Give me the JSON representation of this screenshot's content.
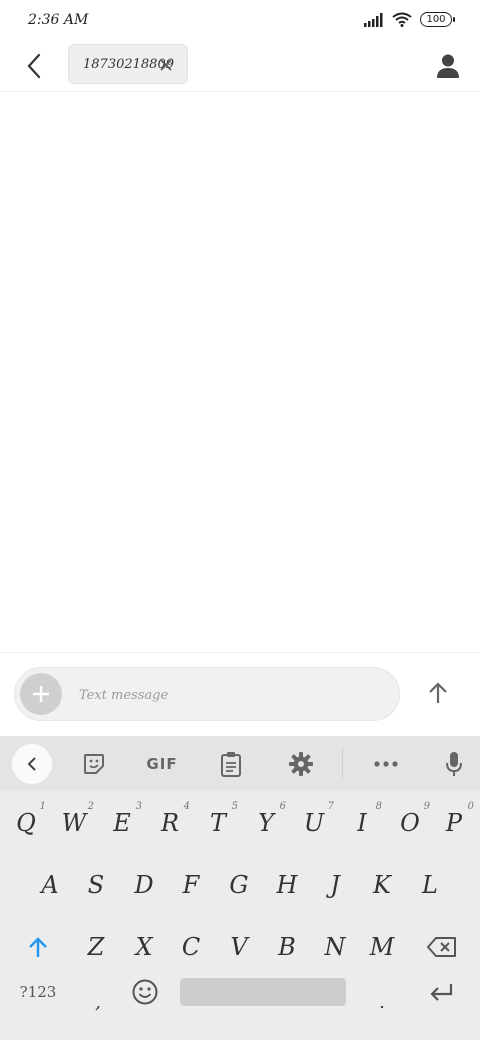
{
  "status_bar": {
    "time": "2:36 AM",
    "battery": "100"
  },
  "header": {
    "recipient": "18730218809"
  },
  "composer": {
    "placeholder": "Text message"
  },
  "keyboard": {
    "toolbar": {
      "gif_label": "GIF"
    },
    "row1": [
      {
        "label": "Q",
        "hint": "1"
      },
      {
        "label": "W",
        "hint": "2"
      },
      {
        "label": "E",
        "hint": "3"
      },
      {
        "label": "R",
        "hint": "4"
      },
      {
        "label": "T",
        "hint": "5"
      },
      {
        "label": "Y",
        "hint": "6"
      },
      {
        "label": "U",
        "hint": "7"
      },
      {
        "label": "I",
        "hint": "8"
      },
      {
        "label": "O",
        "hint": "9"
      },
      {
        "label": "P",
        "hint": "0"
      }
    ],
    "row2": [
      "A",
      "S",
      "D",
      "F",
      "G",
      "H",
      "J",
      "K",
      "L"
    ],
    "row3": [
      "Z",
      "X",
      "C",
      "V",
      "B",
      "N",
      "M"
    ],
    "row4": {
      "symbols": "?123",
      "comma": ",",
      "period": "."
    },
    "accent_color": "#2196f3"
  }
}
